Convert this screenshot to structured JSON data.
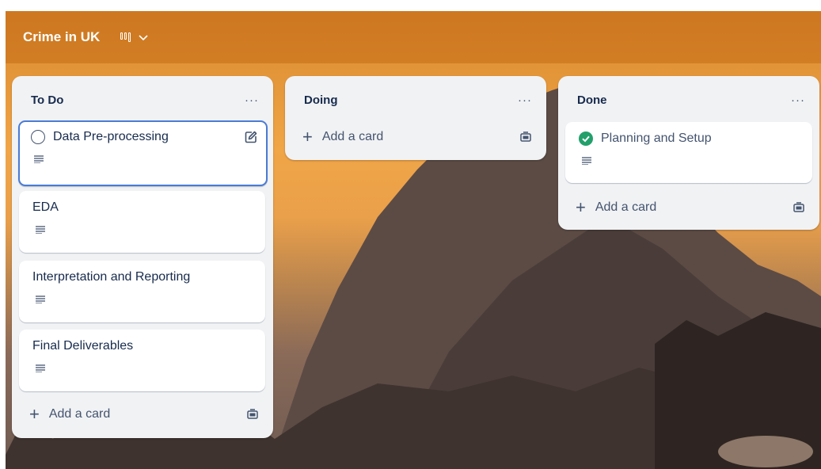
{
  "board": {
    "title": "Crime in UK"
  },
  "lists": [
    {
      "title": "To Do",
      "more": "···",
      "cards": [
        {
          "title": "Data Pre-processing"
        },
        {
          "title": "EDA"
        },
        {
          "title": "Interpretation and Reporting"
        },
        {
          "title": "Final Deliverables"
        }
      ],
      "add_label": "Add a card"
    },
    {
      "title": "Doing",
      "more": "···",
      "cards": [],
      "add_label": "Add a card"
    },
    {
      "title": "Done",
      "more": "···",
      "cards": [
        {
          "title": "Planning and Setup"
        }
      ],
      "add_label": "Add a card"
    }
  ],
  "colors": {
    "accent_focus": "#4a7bd6",
    "done_check": "#22a06b",
    "header": "#c46c16"
  },
  "icons": [
    "board-view-icon",
    "chevron-down-icon",
    "more-icon",
    "circle-checkbox-icon",
    "edit-icon",
    "description-icon",
    "plus-icon",
    "card-template-icon",
    "check-circle-icon"
  ]
}
